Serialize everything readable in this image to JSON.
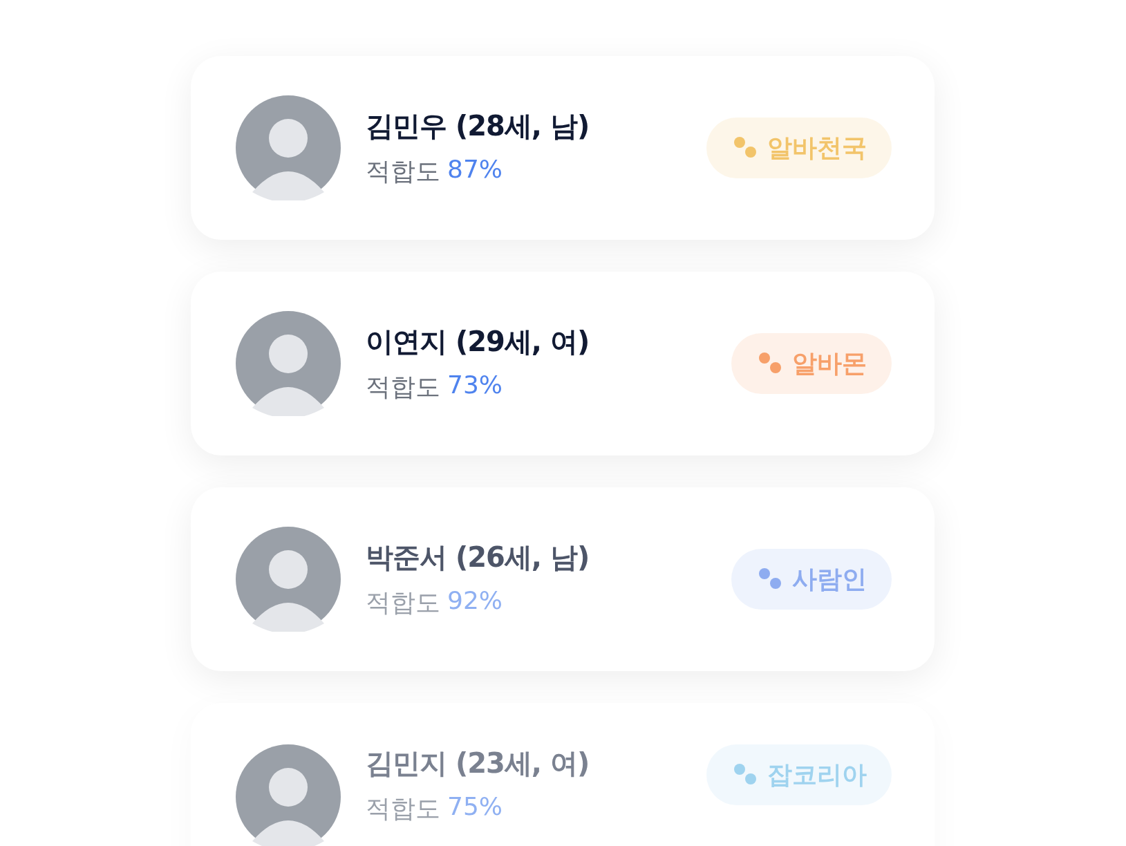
{
  "candidates": [
    {
      "name": "김민우 (28세, 남)",
      "fit_label": "적합도",
      "fit_value": "87%",
      "source": {
        "label": "알바천국",
        "color": "#f2c46a"
      }
    },
    {
      "name": "이연지 (29세, 여)",
      "fit_label": "적합도",
      "fit_value": "73%",
      "source": {
        "label": "알바몬",
        "color": "#f7a06a"
      }
    },
    {
      "name": "박준서 (26세, 남)",
      "fit_label": "적합도",
      "fit_value": "92%",
      "source": {
        "label": "사람인",
        "color": "#8eacf0"
      }
    },
    {
      "name": "김민지 (23세, 여)",
      "fit_label": "적합도",
      "fit_value": "75%",
      "source": {
        "label": "잡코리아",
        "color": "#9fd3ef"
      }
    }
  ]
}
